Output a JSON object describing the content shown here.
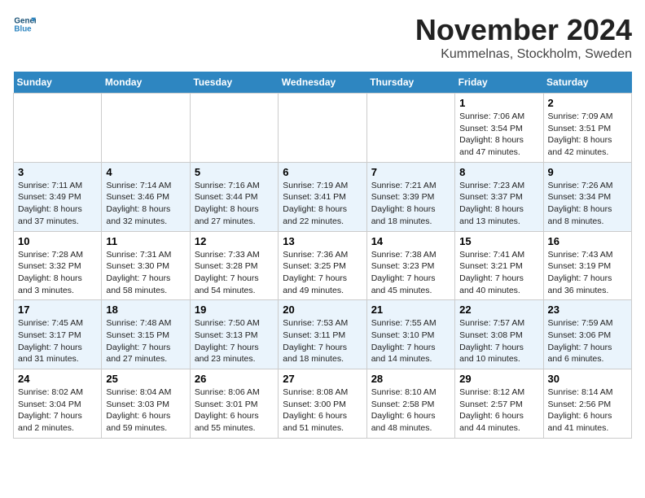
{
  "logo": {
    "line1": "General",
    "line2": "Blue"
  },
  "title": "November 2024",
  "subtitle": "Kummelnas, Stockholm, Sweden",
  "days_of_week": [
    "Sunday",
    "Monday",
    "Tuesday",
    "Wednesday",
    "Thursday",
    "Friday",
    "Saturday"
  ],
  "weeks": [
    [
      {
        "day": "",
        "info": ""
      },
      {
        "day": "",
        "info": ""
      },
      {
        "day": "",
        "info": ""
      },
      {
        "day": "",
        "info": ""
      },
      {
        "day": "",
        "info": ""
      },
      {
        "day": "1",
        "info": "Sunrise: 7:06 AM\nSunset: 3:54 PM\nDaylight: 8 hours and 47 minutes."
      },
      {
        "day": "2",
        "info": "Sunrise: 7:09 AM\nSunset: 3:51 PM\nDaylight: 8 hours and 42 minutes."
      }
    ],
    [
      {
        "day": "3",
        "info": "Sunrise: 7:11 AM\nSunset: 3:49 PM\nDaylight: 8 hours and 37 minutes."
      },
      {
        "day": "4",
        "info": "Sunrise: 7:14 AM\nSunset: 3:46 PM\nDaylight: 8 hours and 32 minutes."
      },
      {
        "day": "5",
        "info": "Sunrise: 7:16 AM\nSunset: 3:44 PM\nDaylight: 8 hours and 27 minutes."
      },
      {
        "day": "6",
        "info": "Sunrise: 7:19 AM\nSunset: 3:41 PM\nDaylight: 8 hours and 22 minutes."
      },
      {
        "day": "7",
        "info": "Sunrise: 7:21 AM\nSunset: 3:39 PM\nDaylight: 8 hours and 18 minutes."
      },
      {
        "day": "8",
        "info": "Sunrise: 7:23 AM\nSunset: 3:37 PM\nDaylight: 8 hours and 13 minutes."
      },
      {
        "day": "9",
        "info": "Sunrise: 7:26 AM\nSunset: 3:34 PM\nDaylight: 8 hours and 8 minutes."
      }
    ],
    [
      {
        "day": "10",
        "info": "Sunrise: 7:28 AM\nSunset: 3:32 PM\nDaylight: 8 hours and 3 minutes."
      },
      {
        "day": "11",
        "info": "Sunrise: 7:31 AM\nSunset: 3:30 PM\nDaylight: 7 hours and 58 minutes."
      },
      {
        "day": "12",
        "info": "Sunrise: 7:33 AM\nSunset: 3:28 PM\nDaylight: 7 hours and 54 minutes."
      },
      {
        "day": "13",
        "info": "Sunrise: 7:36 AM\nSunset: 3:25 PM\nDaylight: 7 hours and 49 minutes."
      },
      {
        "day": "14",
        "info": "Sunrise: 7:38 AM\nSunset: 3:23 PM\nDaylight: 7 hours and 45 minutes."
      },
      {
        "day": "15",
        "info": "Sunrise: 7:41 AM\nSunset: 3:21 PM\nDaylight: 7 hours and 40 minutes."
      },
      {
        "day": "16",
        "info": "Sunrise: 7:43 AM\nSunset: 3:19 PM\nDaylight: 7 hours and 36 minutes."
      }
    ],
    [
      {
        "day": "17",
        "info": "Sunrise: 7:45 AM\nSunset: 3:17 PM\nDaylight: 7 hours and 31 minutes."
      },
      {
        "day": "18",
        "info": "Sunrise: 7:48 AM\nSunset: 3:15 PM\nDaylight: 7 hours and 27 minutes."
      },
      {
        "day": "19",
        "info": "Sunrise: 7:50 AM\nSunset: 3:13 PM\nDaylight: 7 hours and 23 minutes."
      },
      {
        "day": "20",
        "info": "Sunrise: 7:53 AM\nSunset: 3:11 PM\nDaylight: 7 hours and 18 minutes."
      },
      {
        "day": "21",
        "info": "Sunrise: 7:55 AM\nSunset: 3:10 PM\nDaylight: 7 hours and 14 minutes."
      },
      {
        "day": "22",
        "info": "Sunrise: 7:57 AM\nSunset: 3:08 PM\nDaylight: 7 hours and 10 minutes."
      },
      {
        "day": "23",
        "info": "Sunrise: 7:59 AM\nSunset: 3:06 PM\nDaylight: 7 hours and 6 minutes."
      }
    ],
    [
      {
        "day": "24",
        "info": "Sunrise: 8:02 AM\nSunset: 3:04 PM\nDaylight: 7 hours and 2 minutes."
      },
      {
        "day": "25",
        "info": "Sunrise: 8:04 AM\nSunset: 3:03 PM\nDaylight: 6 hours and 59 minutes."
      },
      {
        "day": "26",
        "info": "Sunrise: 8:06 AM\nSunset: 3:01 PM\nDaylight: 6 hours and 55 minutes."
      },
      {
        "day": "27",
        "info": "Sunrise: 8:08 AM\nSunset: 3:00 PM\nDaylight: 6 hours and 51 minutes."
      },
      {
        "day": "28",
        "info": "Sunrise: 8:10 AM\nSunset: 2:58 PM\nDaylight: 6 hours and 48 minutes."
      },
      {
        "day": "29",
        "info": "Sunrise: 8:12 AM\nSunset: 2:57 PM\nDaylight: 6 hours and 44 minutes."
      },
      {
        "day": "30",
        "info": "Sunrise: 8:14 AM\nSunset: 2:56 PM\nDaylight: 6 hours and 41 minutes."
      }
    ]
  ]
}
